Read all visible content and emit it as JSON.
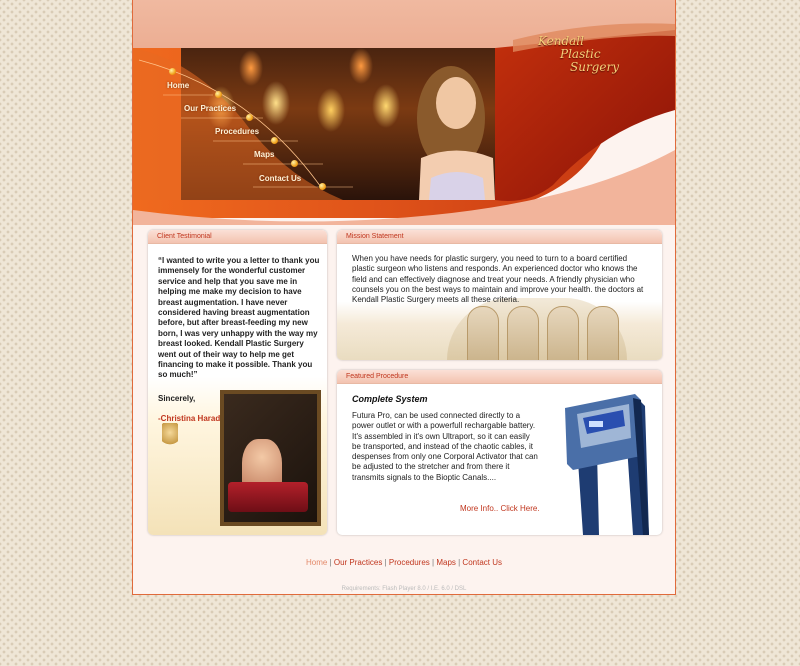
{
  "site": {
    "logo_lines": [
      "Kendall",
      "Plastic",
      "Surgery"
    ],
    "colors": {
      "accent": "#c0361e",
      "orange": "#e8561a",
      "frame_border": "#e06a3b"
    }
  },
  "nav": {
    "items": [
      {
        "label": "Home"
      },
      {
        "label": "Our Practices"
      },
      {
        "label": "Procedures"
      },
      {
        "label": "Maps"
      },
      {
        "label": "Contact Us"
      }
    ]
  },
  "testimonial": {
    "heading": "Client Testimonial",
    "quote": "“I wanted to write you a letter to thank you immensely for the wonderful customer service and help that you save me in helping me make my decision to have breast augmentation. I have never considered having breast augmentation before, but after breast-feeding my new born, I was very unhappy with the way my breast looked. Kendall Plastic Surgery went out of their way to help me get financing to make it possible. Thank you so much!”",
    "signoff": "Sincerely,",
    "author": "-Christina Harada"
  },
  "mission": {
    "heading": "Mission Statement",
    "body": "When you have needs for plastic surgery, you need to turn to a board certified plastic surgeon who listens and responds. An experienced doctor who knows the field and can effectively diagnose and treat your needs. A friendly physician who counsels you on the best ways to maintain and improve your health. the doctors at Kendall Plastic Surgery meets all these criteria."
  },
  "featured": {
    "heading": "Featured Procedure",
    "title": "Complete System",
    "body": "Futura Pro, can be used connected directly to a power outlet or with a powerfull rechargable battery. It's assembled in it's own Ultraport, so it can easily be transported, and instead of the chaotic cables, it despenses from only one Corporal Activator that can be adjusted to the stretcher and from there it transmits signals to the Bioptic Canals....",
    "more_link": "More Info.. Click Here."
  },
  "footer": {
    "links": [
      "Home",
      "Our Practices",
      "Procedures",
      "Maps",
      "Contact Us"
    ],
    "separator": " | ",
    "requirements": "Requirements: Flash Player 8.0 / I.E. 6.0 / DSL"
  }
}
